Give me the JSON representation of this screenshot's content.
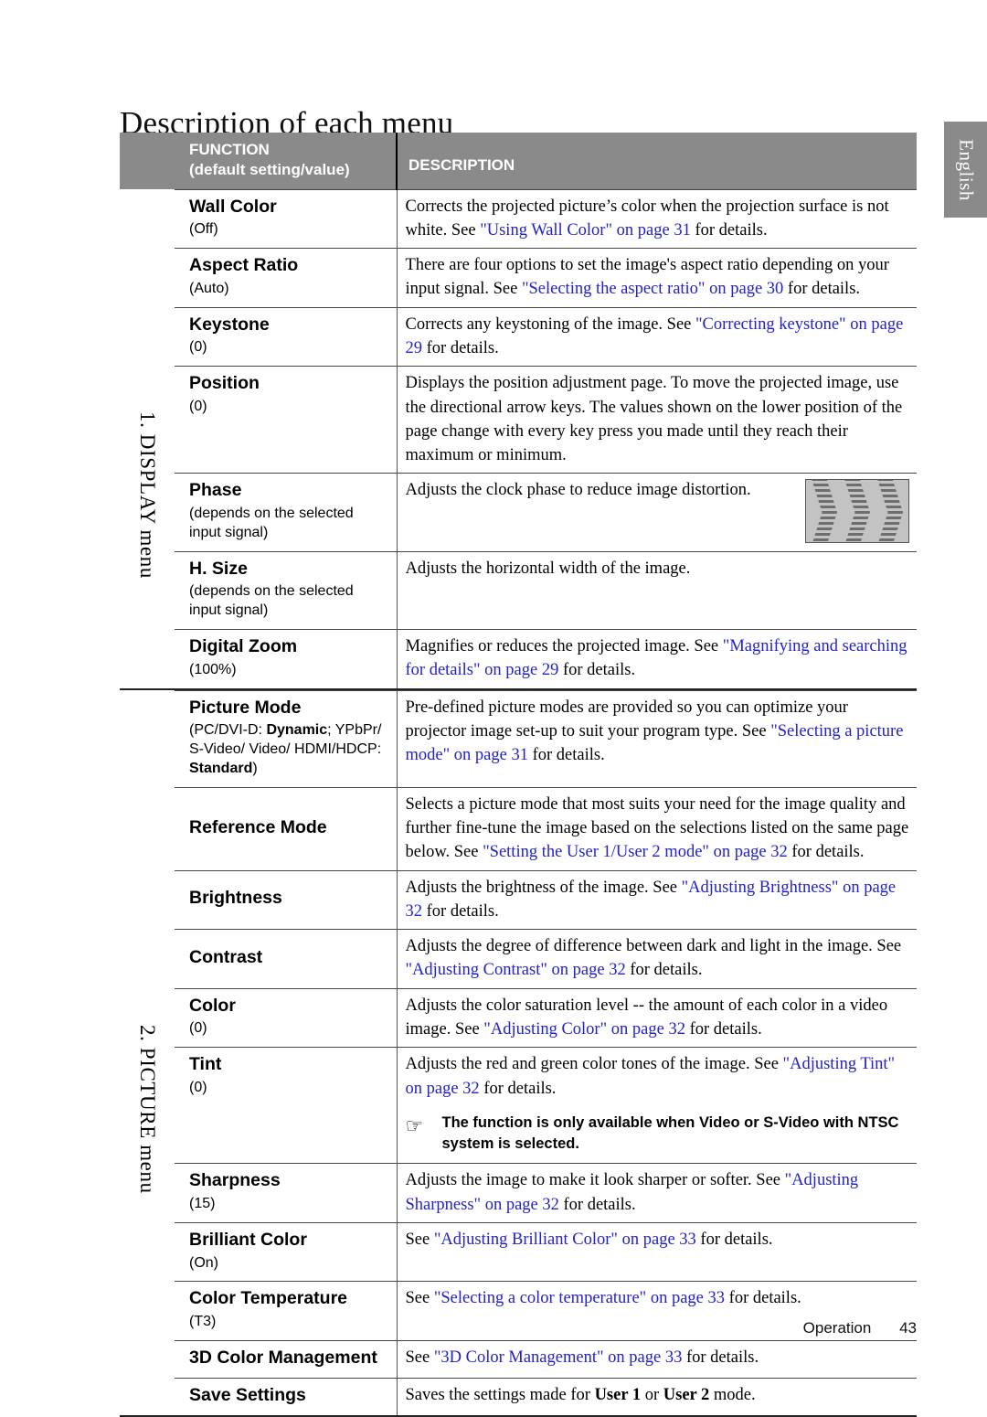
{
  "page": {
    "title": "Description of each menu",
    "language_tab": "English",
    "footer_section": "Operation",
    "footer_page": "43",
    "link_color": "#2222cc",
    "header_bg": "#8a8a8a"
  },
  "table": {
    "header": {
      "function": "FUNCTION",
      "function_sub": "(default setting/value)",
      "description": "DESCRIPTION"
    },
    "sections": [
      {
        "menu_label": "1. DISPLAY menu",
        "rows": [
          {
            "name": "Wall Color",
            "default": "(Off)",
            "desc_parts": [
              {
                "t": "Corrects the projected picture’s color when the projection surface is not white. See ",
                "link": false
              },
              {
                "t": "\"Using Wall Color\" on page 31",
                "link": true
              },
              {
                "t": " for details.",
                "link": false
              }
            ]
          },
          {
            "name": "Aspect Ratio",
            "default": "(Auto)",
            "desc_parts": [
              {
                "t": "There are four options to set the image's aspect ratio depending on your input signal. See ",
                "link": false
              },
              {
                "t": "\"Selecting the aspect ratio\" on page 30",
                "link": true
              },
              {
                "t": " for details.",
                "link": false
              }
            ]
          },
          {
            "name": "Keystone",
            "default": "(0)",
            "desc_parts": [
              {
                "t": "Corrects any keystoning of the image. See ",
                "link": false
              },
              {
                "t": "\"Correcting keystone\" on page 29",
                "link": true
              },
              {
                "t": " for details.",
                "link": false
              }
            ]
          },
          {
            "name": "Position",
            "default": "(0)",
            "desc_parts": [
              {
                "t": "Displays the position adjustment page. To move the projected image, use the directional arrow keys. The values shown on the lower position of the page change with every key press you made until they reach their maximum or minimum.",
                "link": false
              }
            ]
          },
          {
            "name": "Phase",
            "default": "(depends on the selected input signal)",
            "desc_parts": [
              {
                "t": "Adjusts the clock phase to reduce image distortion.",
                "link": false
              }
            ],
            "has_image": true,
            "image_name": "phase-sample-image"
          },
          {
            "name": "H. Size",
            "default": "(depends on the selected input signal)",
            "desc_parts": [
              {
                "t": "Adjusts the horizontal width of the image.",
                "link": false
              }
            ]
          },
          {
            "name": "Digital Zoom",
            "default": "(100%)",
            "desc_parts": [
              {
                "t": "Magnifies or reduces the projected image. See ",
                "link": false
              },
              {
                "t": "\"Magnifying and searching for details\" on page 29",
                "link": true
              },
              {
                "t": " for details.",
                "link": false
              }
            ]
          }
        ]
      },
      {
        "menu_label": "2. PICTURE menu",
        "rows": [
          {
            "name": "Picture Mode",
            "default_html": "(PC/DVI-D: <b>Dynamic</b>; YPbPr/ S-Video/ Video/ HDMI/HDCP: <b>Standard</b>)",
            "desc_parts": [
              {
                "t": "Pre-defined picture modes are provided so you can optimize your projector image set-up to suit your program type. See ",
                "link": false
              },
              {
                "t": "\"Selecting a picture mode\" on page 31",
                "link": true
              },
              {
                "t": " for details.",
                "link": false
              }
            ]
          },
          {
            "name": "Reference Mode",
            "default": "",
            "desc_parts": [
              {
                "t": "Selects a picture mode that most suits your need for the image quality and further fine-tune the image based on the selections listed on the same page below. See ",
                "link": false
              },
              {
                "t": "\"Setting the User 1/User 2 mode\" on page 32",
                "link": true
              },
              {
                "t": " for details.",
                "link": false
              }
            ]
          },
          {
            "name": "Brightness",
            "default": "",
            "desc_parts": [
              {
                "t": "Adjusts the brightness of the image. See ",
                "link": false
              },
              {
                "t": "\"Adjusting Brightness\" on page 32",
                "link": true
              },
              {
                "t": " for details.",
                "link": false
              }
            ]
          },
          {
            "name": "Contrast",
            "default": "",
            "desc_parts": [
              {
                "t": "Adjusts the degree of difference between dark and light in the image. See ",
                "link": false
              },
              {
                "t": "\"Adjusting Contrast\" on page 32",
                "link": true
              },
              {
                "t": " for details.",
                "link": false
              }
            ]
          },
          {
            "name": "Color",
            "default": "(0)",
            "desc_parts": [
              {
                "t": "Adjusts the color saturation level -- the amount of each color in a video image. See ",
                "link": false
              },
              {
                "t": "\"Adjusting Color\" on page 32",
                "link": true
              },
              {
                "t": " for details.",
                "link": false
              }
            ]
          },
          {
            "name": "Tint",
            "default": "(0)",
            "desc_parts": [
              {
                "t": "Adjusts the red and green color tones of the image. See ",
                "link": false
              },
              {
                "t": "\"Adjusting Tint\" on page 32",
                "link": true
              },
              {
                "t": " for details.",
                "link": false
              }
            ],
            "note": "The function is only available when Video or S-Video with NTSC system is selected."
          },
          {
            "name": "Sharpness",
            "default": "(15)",
            "desc_parts": [
              {
                "t": "Adjusts the image to make it look sharper or softer. See ",
                "link": false
              },
              {
                "t": "\"Adjusting Sharpness\" on page 32",
                "link": true
              },
              {
                "t": " for details.",
                "link": false
              }
            ]
          },
          {
            "name": "Brilliant Color",
            "default": "(On)",
            "desc_parts": [
              {
                "t": "See ",
                "link": false
              },
              {
                "t": "\"Adjusting Brilliant Color\" on page 33",
                "link": true
              },
              {
                "t": " for details.",
                "link": false
              }
            ]
          },
          {
            "name": "Color Temperature",
            "default": "(T3)",
            "desc_parts": [
              {
                "t": "See ",
                "link": false
              },
              {
                "t": "\"Selecting a color temperature\" on page 33",
                "link": true
              },
              {
                "t": " for details.",
                "link": false
              }
            ]
          },
          {
            "name": "3D Color Management",
            "default": "",
            "desc_parts": [
              {
                "t": "See ",
                "link": false
              },
              {
                "t": "\"3D Color Management\" on page 33",
                "link": true
              },
              {
                "t": " for details.",
                "link": false
              }
            ]
          },
          {
            "name": "Save Settings",
            "default": "",
            "desc_html": "Saves the settings made for <b>User 1</b> or <b>User 2</b> mode."
          }
        ]
      }
    ]
  }
}
